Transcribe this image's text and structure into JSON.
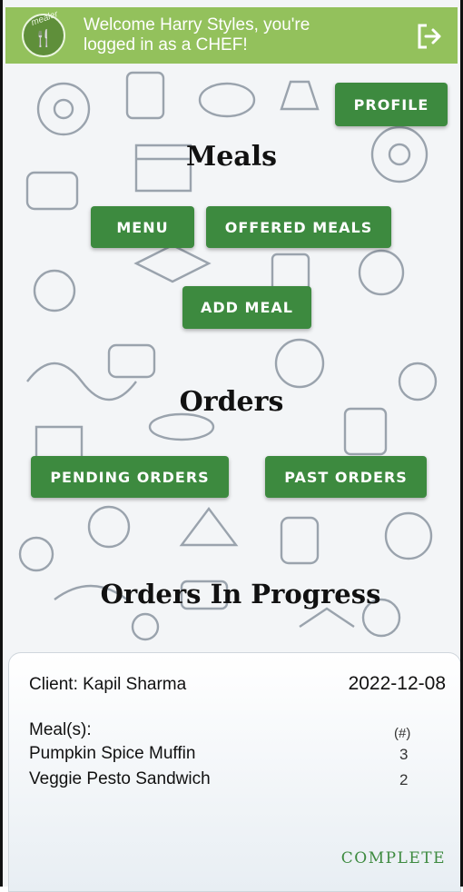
{
  "header": {
    "logo_text": "mealer",
    "welcome": "Welcome Harry Styles, you're logged in as a CHEF!",
    "logout_icon": "logout-icon"
  },
  "profile_button": "PROFILE",
  "meals_section": {
    "title": "Meals",
    "menu_button": "MENU",
    "offered_button": "OFFERED MEALS",
    "add_button": "ADD MEAL"
  },
  "orders_section": {
    "title": "Orders",
    "pending_button": "PENDING ORDERS",
    "past_button": "PAST ORDERS"
  },
  "progress_section": {
    "title": "Orders In Progress",
    "order": {
      "client": "Client: Kapil Sharma",
      "date": "2022-12-08",
      "meals_label": "Meal(s):",
      "qty_label": "(#)",
      "items": [
        {
          "name": "Pumpkin Spice Muffin",
          "qty": "3"
        },
        {
          "name": "Veggie Pesto Sandwich",
          "qty": "2"
        }
      ],
      "action": "COMPLETE"
    }
  },
  "colors": {
    "header": "#93c15c",
    "button": "#3d8a3f",
    "accent_text": "#3d8a3f"
  }
}
